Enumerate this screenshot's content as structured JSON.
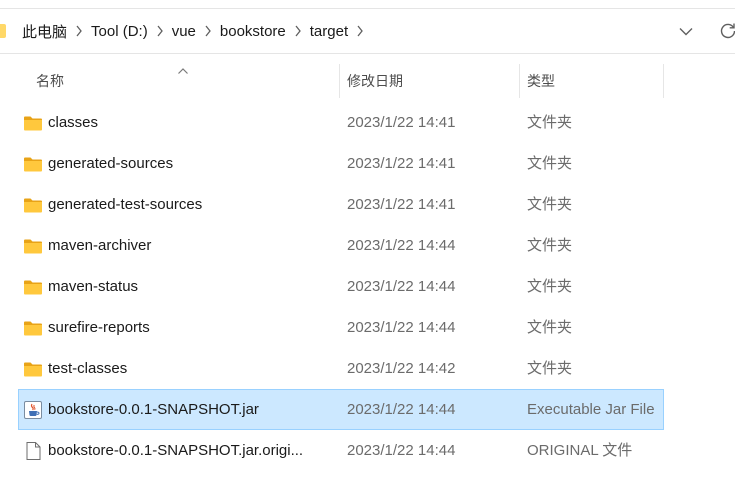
{
  "breadcrumb": {
    "items": [
      "此电脑",
      "Tool (D:)",
      "vue",
      "bookstore",
      "target"
    ]
  },
  "header": {
    "name_label": "名称",
    "date_label": "修改日期",
    "type_label": "类型"
  },
  "files": [
    {
      "name": "classes",
      "date": "2023/1/22 14:41",
      "type": "文件夹",
      "icon": "folder-icon",
      "selected": false
    },
    {
      "name": "generated-sources",
      "date": "2023/1/22 14:41",
      "type": "文件夹",
      "icon": "folder-icon",
      "selected": false
    },
    {
      "name": "generated-test-sources",
      "date": "2023/1/22 14:41",
      "type": "文件夹",
      "icon": "folder-icon",
      "selected": false
    },
    {
      "name": "maven-archiver",
      "date": "2023/1/22 14:44",
      "type": "文件夹",
      "icon": "folder-icon",
      "selected": false
    },
    {
      "name": "maven-status",
      "date": "2023/1/22 14:44",
      "type": "文件夹",
      "icon": "folder-icon",
      "selected": false
    },
    {
      "name": "surefire-reports",
      "date": "2023/1/22 14:44",
      "type": "文件夹",
      "icon": "folder-icon",
      "selected": false
    },
    {
      "name": "test-classes",
      "date": "2023/1/22 14:42",
      "type": "文件夹",
      "icon": "folder-icon",
      "selected": false
    },
    {
      "name": "bookstore-0.0.1-SNAPSHOT.jar",
      "date": "2023/1/22 14:44",
      "type": "Executable Jar File",
      "icon": "java-jar-icon",
      "selected": true
    },
    {
      "name": "bookstore-0.0.1-SNAPSHOT.jar.origi...",
      "date": "2023/1/22 14:44",
      "type": "ORIGINAL 文件",
      "icon": "file-icon",
      "selected": false
    }
  ],
  "colors": {
    "selection_bg": "#cce8ff",
    "selection_border": "#99d1ff",
    "folder": "#ffc83d"
  }
}
